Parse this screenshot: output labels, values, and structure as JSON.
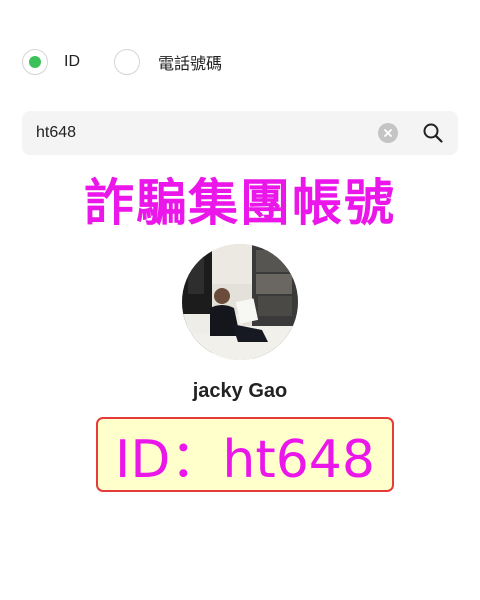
{
  "search_type": {
    "options": [
      {
        "label": "ID",
        "selected": true
      },
      {
        "label": "電話號碼",
        "selected": false
      }
    ],
    "selected_color": "#3bc15a"
  },
  "search": {
    "value": "ht648",
    "clear_icon": "clear-icon",
    "search_icon": "search-icon"
  },
  "overlay": {
    "title": "詐騙集團帳號",
    "title_color": "#ea16ea",
    "id_label": "ID：ht648",
    "id_box_background": "#ffffcc",
    "id_box_border": "#e63b3b"
  },
  "result": {
    "name": "jacky Gao"
  }
}
